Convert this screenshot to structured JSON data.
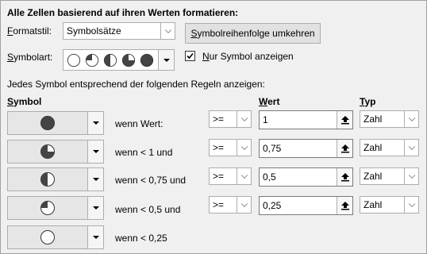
{
  "header": {
    "title": "Alle Zellen basierend auf ihren Werten formatieren:"
  },
  "formatstil": {
    "label": "Formatstil:",
    "value": "Symbolsätze"
  },
  "reverse_button": {
    "label": "Symbolreihenfolge umkehren"
  },
  "symbolart": {
    "label": "Symbolart:",
    "icon_set": "five-quarters-circles"
  },
  "only_symbol": {
    "label": "Nur Symbol anzeigen",
    "checked": true
  },
  "rules_intro": "Jedes Symbol entsprechend der folgenden Regeln anzeigen:",
  "columns": {
    "symbol": "Symbol",
    "wert": "Wert",
    "typ": "Typ"
  },
  "rules": [
    {
      "icon": "full-circle-icon",
      "condition": "wenn Wert:",
      "operator": ">=",
      "value": "1",
      "type": "Zahl"
    },
    {
      "icon": "three-quarter-circle-icon",
      "condition": "wenn < 1 und",
      "operator": ">=",
      "value": "0,75",
      "type": "Zahl"
    },
    {
      "icon": "half-circle-icon",
      "condition": "wenn < 0,75 und",
      "operator": ">=",
      "value": "0,5",
      "type": "Zahl"
    },
    {
      "icon": "quarter-circle-icon",
      "condition": "wenn < 0,5 und",
      "operator": ">=",
      "value": "0,25",
      "type": "Zahl"
    },
    {
      "icon": "empty-circle-icon",
      "condition": "wenn < 0,25"
    }
  ]
}
